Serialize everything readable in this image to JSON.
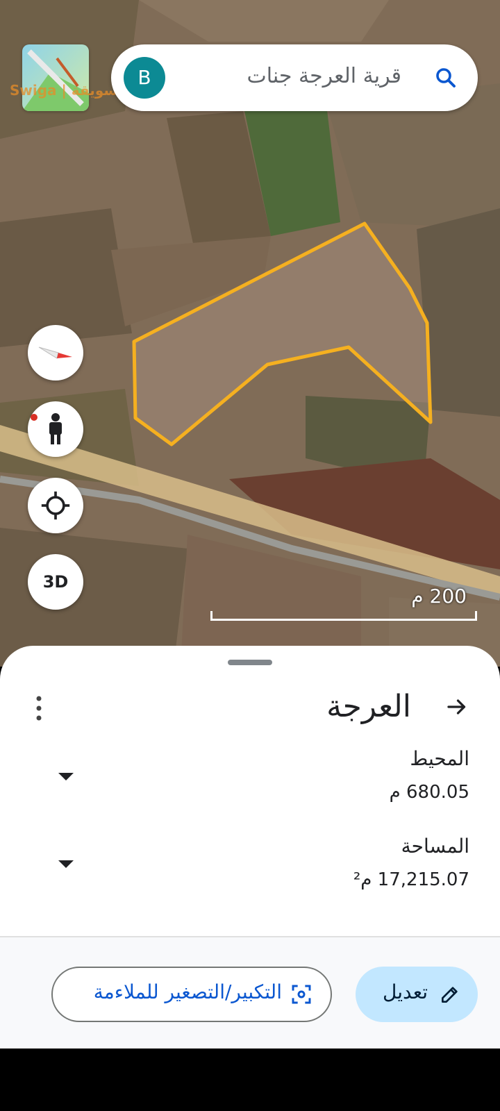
{
  "search": {
    "query": "قرية العرجة جنات",
    "avatar_letter": "B"
  },
  "watermark": {
    "text": "Swiga | سويقة"
  },
  "map_controls": {
    "three_d_label": "3D"
  },
  "scale": {
    "label": "200 م"
  },
  "sheet": {
    "title": "العرجة",
    "perimeter_label": "المحيط",
    "perimeter_value": "680.05 م",
    "area_label": "المساحة",
    "area_value": "17,215.07 م²"
  },
  "actions": {
    "edit_label": "تعديل",
    "zoom_fit_label": "التكبير/التصغير للملاءمة"
  },
  "colors": {
    "polygon": "#f5b020",
    "accent": "#0b57d0",
    "edit_bg": "#c2e7ff",
    "avatar": "#0c8a94"
  }
}
